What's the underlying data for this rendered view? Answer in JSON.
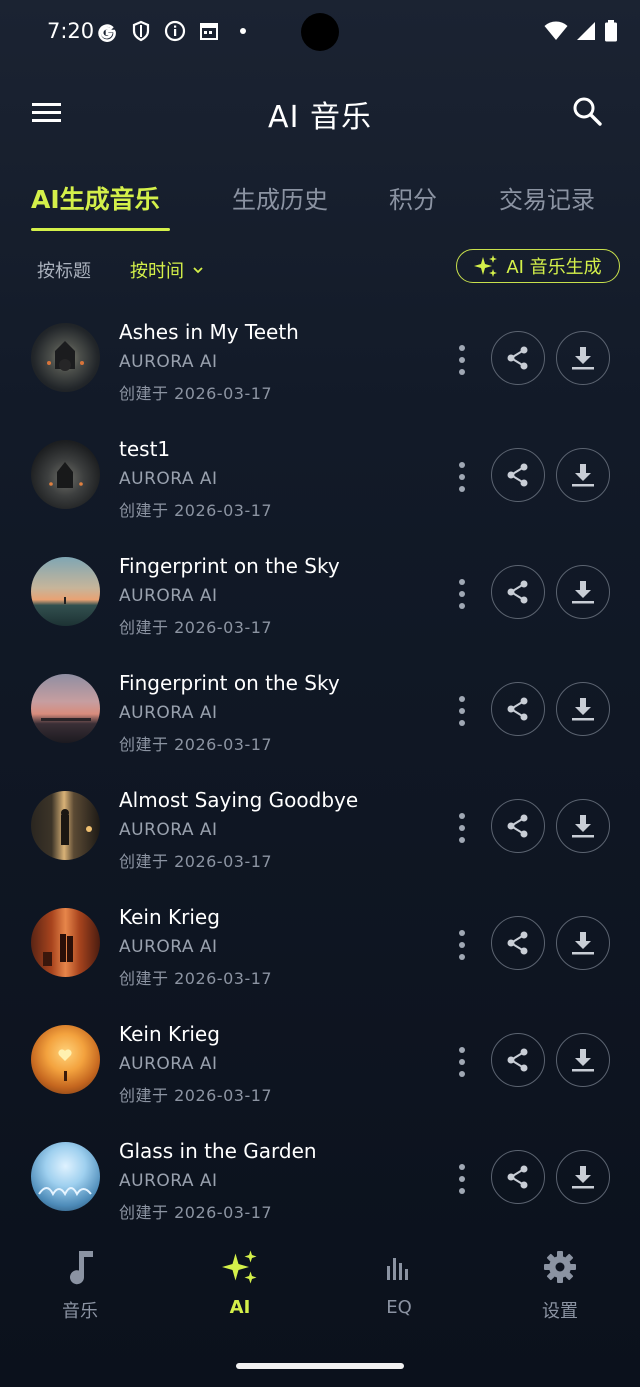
{
  "status_bar": {
    "time": "7:20"
  },
  "app_bar": {
    "title": "AI 音乐"
  },
  "tabs": [
    {
      "label": "AI生成音乐",
      "active": true
    },
    {
      "label": "生成历史",
      "active": false
    },
    {
      "label": "积分",
      "active": false
    },
    {
      "label": "交易记录",
      "active": false
    }
  ],
  "filters": {
    "by_title": "按标题",
    "by_time": "按时间",
    "generate_button": "AI 音乐生成"
  },
  "songs": [
    {
      "title": "Ashes in My Teeth",
      "artist": "AURORA AI",
      "created": "创建于 2026-03-17"
    },
    {
      "title": "test1",
      "artist": "AURORA AI",
      "created": "创建于 2026-03-17"
    },
    {
      "title": "Fingerprint on the Sky",
      "artist": "AURORA AI",
      "created": "创建于 2026-03-17"
    },
    {
      "title": "Fingerprint on the Sky",
      "artist": "AURORA AI",
      "created": "创建于 2026-03-17"
    },
    {
      "title": "Almost Saying Goodbye",
      "artist": "AURORA AI",
      "created": "创建于 2026-03-17"
    },
    {
      "title": "Kein Krieg",
      "artist": "AURORA AI",
      "created": "创建于 2026-03-17"
    },
    {
      "title": "Kein Krieg",
      "artist": "AURORA AI",
      "created": "创建于 2026-03-17"
    },
    {
      "title": "Glass in the Garden",
      "artist": "AURORA AI",
      "created": "创建于 2026-03-17"
    }
  ],
  "bottom_nav": [
    {
      "label": "音乐",
      "icon": "music-note-icon",
      "active": false
    },
    {
      "label": "AI",
      "icon": "sparkle-icon",
      "active": true
    },
    {
      "label": "EQ",
      "icon": "equalizer-icon",
      "active": false
    },
    {
      "label": "设置",
      "icon": "gear-icon",
      "active": false
    }
  ],
  "colors": {
    "accent": "#d4f04a",
    "background": "#121a28"
  }
}
